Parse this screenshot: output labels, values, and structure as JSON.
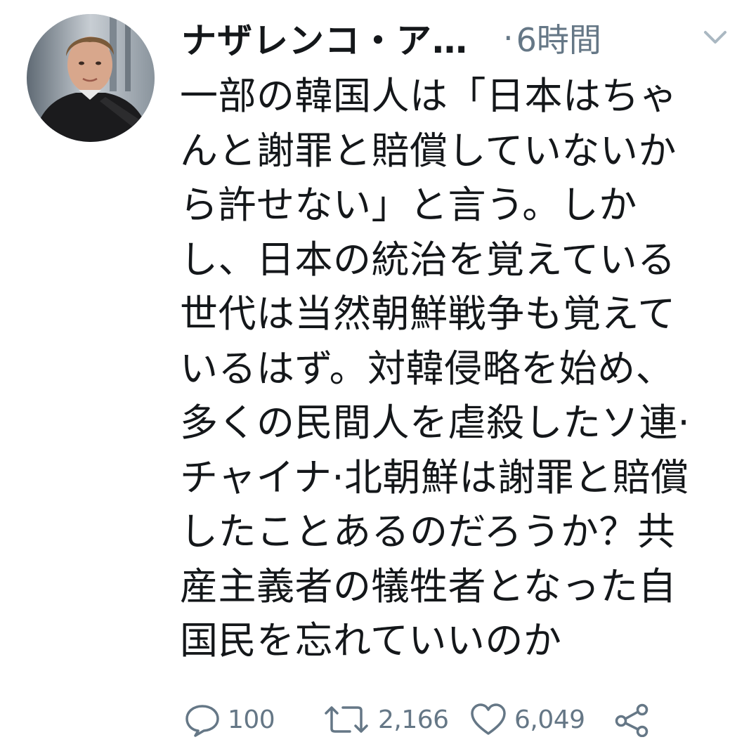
{
  "tweet": {
    "author": {
      "display_name": "ナザレンコ・ア…",
      "avatar_icon": "user-avatar-photo"
    },
    "separator": "·",
    "timestamp": "6時間",
    "menu_icon": "chevron-down-icon",
    "text_lines": [
      "一部の韓国人は「日本はちゃ",
      "んと謝罪と賠償していないか",
      "ら許せない」と言う。しか",
      "し、日本の統治を覚えている",
      "世代は当然朝鮮戦争も覚えて",
      "いるはず。対韓侵略を始め、",
      "多くの民間人を虐殺したソ連·",
      "チャイナ·北朝鮮は謝罪と賠償",
      "したことあるのだろうか？共",
      "産主義者の犠牲者となった自",
      "国民を忘れていいのか"
    ],
    "actions": {
      "reply": {
        "icon": "reply-icon",
        "count": "100"
      },
      "retweet": {
        "icon": "retweet-icon",
        "count": "2,166"
      },
      "like": {
        "icon": "heart-icon",
        "count": "6,049"
      },
      "share": {
        "icon": "share-icon"
      }
    }
  },
  "colors": {
    "text": "#14171a",
    "muted": "#657786",
    "background": "#ffffff"
  }
}
